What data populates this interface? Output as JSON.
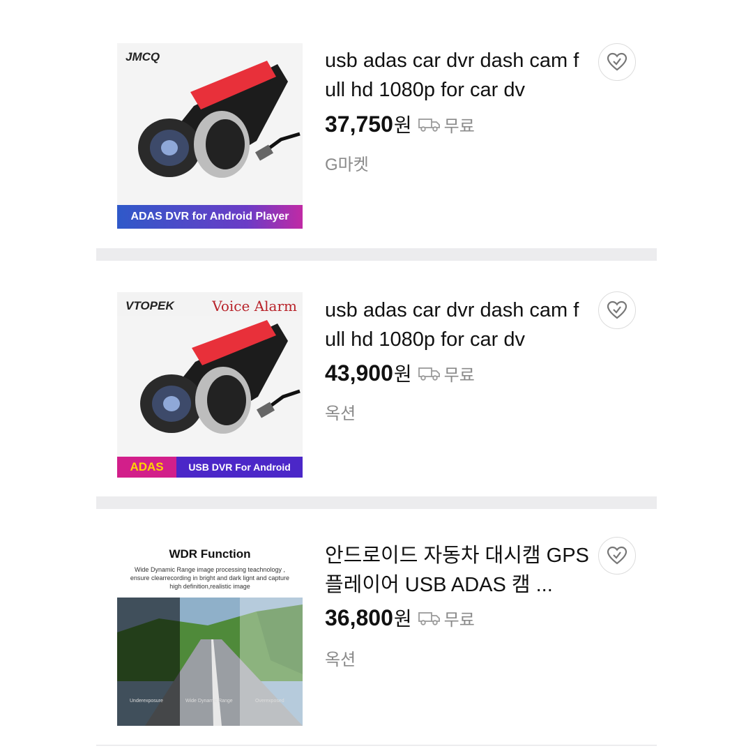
{
  "items": [
    {
      "title": "usb adas car dvr dash cam full hd 1080p for car dv",
      "price": "37,750",
      "currency": "원",
      "shipping": "무료",
      "seller": "G마켓",
      "thumb": {
        "brand": "JMCQ",
        "banner": "ADAS DVR for Android Player"
      }
    },
    {
      "title": "usb adas car dvr dash cam full hd 1080p for car dv",
      "price": "43,900",
      "currency": "원",
      "shipping": "무료",
      "seller": "옥션",
      "thumb": {
        "brand": "VTOPEK",
        "headline": "Voice Alarm",
        "banner_left": "ADAS",
        "banner_right": "USB DVR For Android"
      }
    },
    {
      "title": "안드로이드 자동차 대시캠 GPS 플레이어 USB ADAS 캠 ...",
      "price": "36,800",
      "currency": "원",
      "shipping": "무료",
      "seller": "옥션",
      "thumb": {
        "heading": "WDR Function",
        "desc": "Wide Dynamic Range image processing teachnology , ensure clearrecording in bright and dark lignt and capture high definition,realistic image",
        "captions": [
          "Underexposure",
          "Wide Dynamic Range",
          "Overexposed"
        ]
      }
    }
  ],
  "icons": {
    "wishlist": "heart-check-icon",
    "shipping": "truck-icon"
  }
}
